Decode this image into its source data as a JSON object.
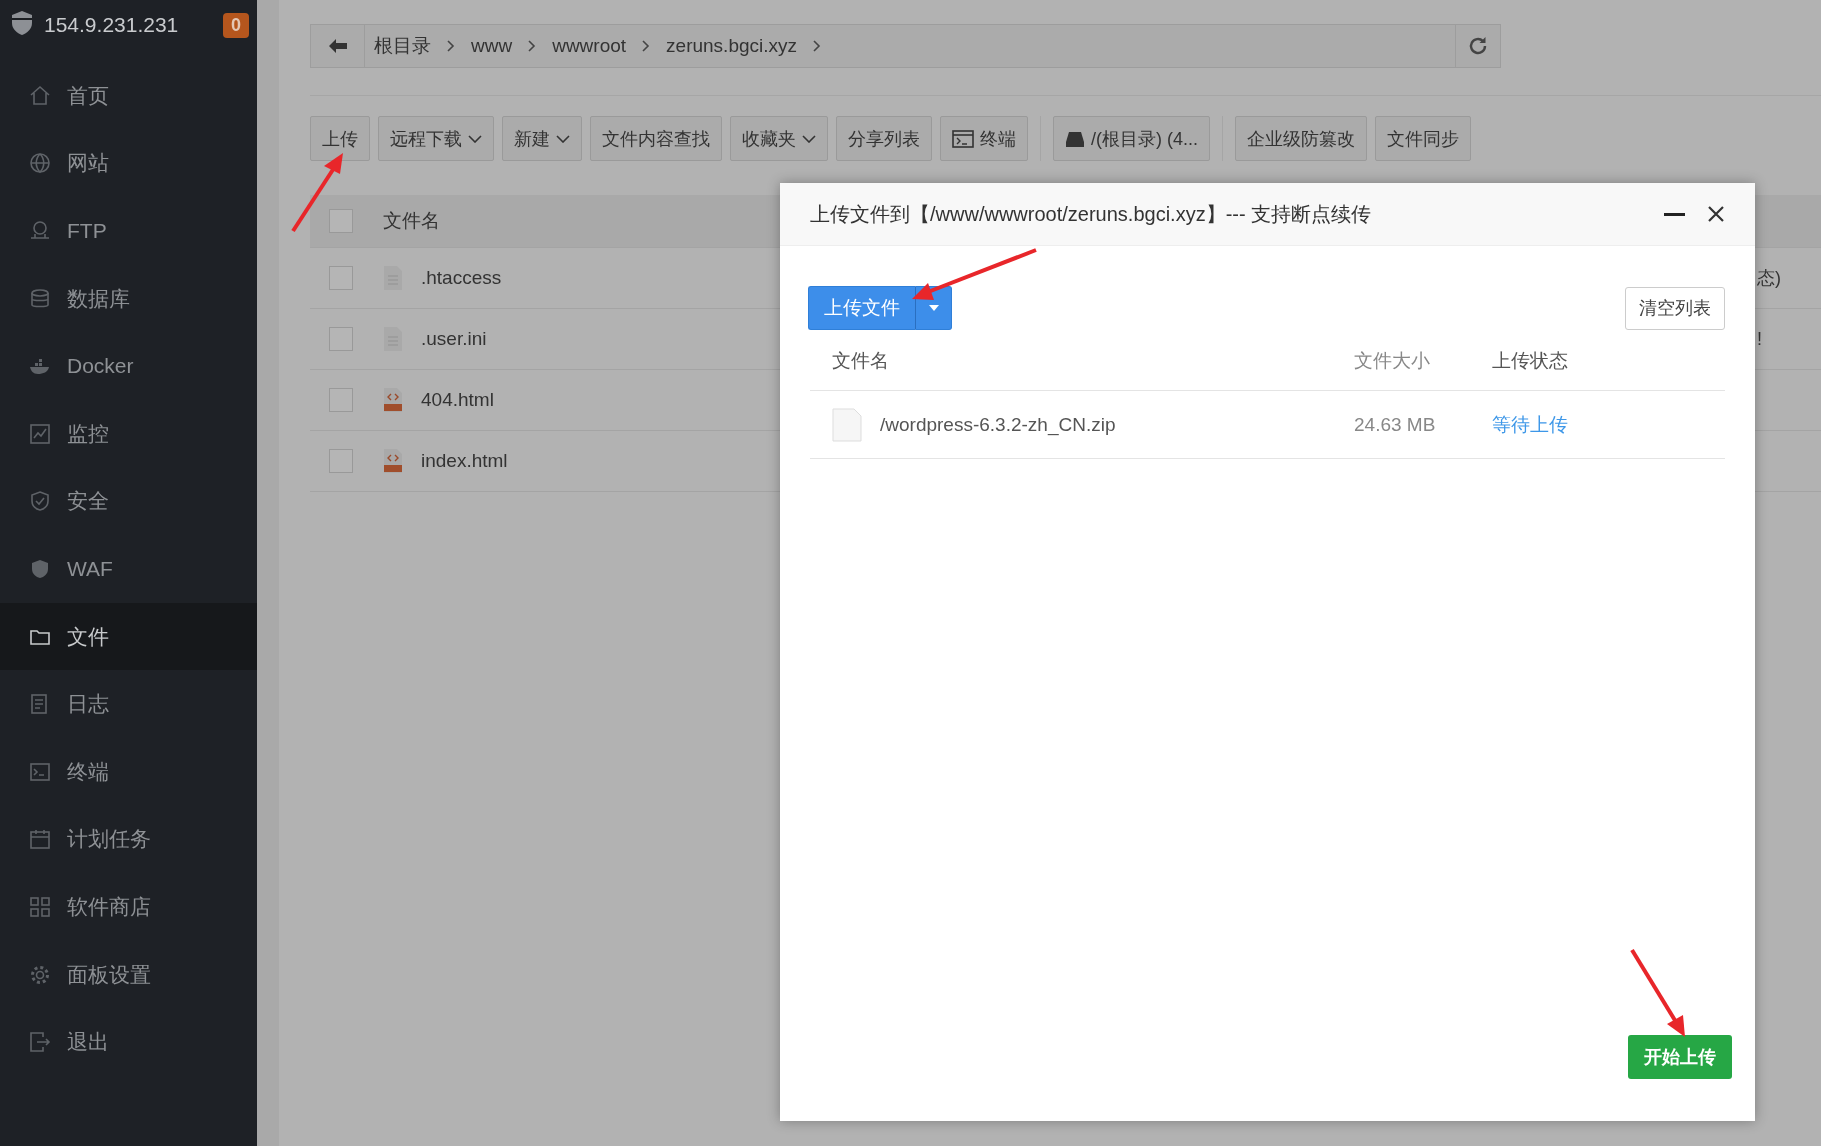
{
  "server": {
    "ip": "154.9.231.231",
    "badge": "0"
  },
  "sidebar": {
    "items": [
      {
        "label": "首页",
        "selected": false
      },
      {
        "label": "网站",
        "selected": false
      },
      {
        "label": "FTP",
        "selected": false
      },
      {
        "label": "数据库",
        "selected": false
      },
      {
        "label": "Docker",
        "selected": false
      },
      {
        "label": "监控",
        "selected": false
      },
      {
        "label": "安全",
        "selected": false
      },
      {
        "label": "WAF",
        "selected": false
      },
      {
        "label": "文件",
        "selected": true
      },
      {
        "label": "日志",
        "selected": false
      },
      {
        "label": "终端",
        "selected": false
      },
      {
        "label": "计划任务",
        "selected": false
      },
      {
        "label": "软件商店",
        "selected": false
      },
      {
        "label": "面板设置",
        "selected": false
      },
      {
        "label": "退出",
        "selected": false
      }
    ]
  },
  "breadcrumb": [
    "根目录",
    "www",
    "wwwroot",
    "zeruns.bgci.xyz"
  ],
  "toolbar": {
    "groups": [
      [
        {
          "label": "上传",
          "kind": "plain"
        },
        {
          "label": "远程下载",
          "kind": "dropdown"
        },
        {
          "label": "新建",
          "kind": "dropdown"
        },
        {
          "label": "文件内容查找",
          "kind": "plain"
        },
        {
          "label": "收藏夹",
          "kind": "dropdown"
        },
        {
          "label": "分享列表",
          "kind": "plain"
        },
        {
          "label": "终端",
          "kind": "terminal"
        }
      ],
      [
        {
          "label": "/(根目录) (4...",
          "kind": "disk"
        }
      ],
      [
        {
          "label": "企业级防篡改",
          "kind": "plain"
        },
        {
          "label": "文件同步",
          "kind": "plain"
        }
      ]
    ]
  },
  "file_table": {
    "header": "文件名",
    "header_checked": false,
    "rows": [
      {
        "name": ".htaccess",
        "kind": "text",
        "checked": false,
        "column_2": "态)"
      },
      {
        "name": ".user.ini",
        "kind": "text",
        "checked": false,
        "column_2": "!"
      },
      {
        "name": "404.html",
        "kind": "html",
        "checked": false
      },
      {
        "name": "index.html",
        "kind": "html",
        "checked": false
      }
    ]
  },
  "dialog": {
    "title": "上传文件到【/www/wwwroot/zeruns.bgci.xyz】--- 支持断点续传",
    "upload_button": "上传文件",
    "clear_button": "清空列表",
    "columns": [
      "文件名",
      "文件大小",
      "上传状态"
    ],
    "files": [
      {
        "name": "/wordpress-6.3.2-zh_CN.zip",
        "size": "24.63 MB",
        "status": "等待上传"
      }
    ],
    "start_button": "开始上传"
  }
}
